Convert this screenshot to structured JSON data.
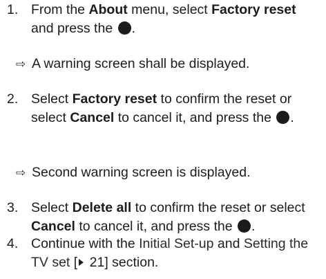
{
  "steps": [
    {
      "num": "1.",
      "t1": "From the ",
      "b1": "About",
      "t2": " menu, select ",
      "b2": "Factory reset",
      "t3": " and press the ",
      "t4": "."
    },
    {
      "num": "2.",
      "t1": "Select ",
      "b1": "Factory reset",
      "t2": " to confirm the reset or select ",
      "b2": "Cancel",
      "t3": " to cancel it, and press the ",
      "t4": "."
    },
    {
      "num": "3.",
      "t1": "Select ",
      "b1": "Delete all",
      "t2": " to confirm the reset or select ",
      "b2": "Cancel",
      "t3": " to cancel it, and press the ",
      "t4": "."
    },
    {
      "num": "4.",
      "t1": "Continue with the ",
      "link1": "Initial Set-up",
      "t2": " and ",
      "link2": "Setting the TV set",
      "ref_open": " [",
      "ref_page": " 21",
      "ref_close": "]",
      "t3": " section."
    }
  ],
  "results": [
    {
      "arrow": "⇨",
      "text": "A warning screen shall be displayed."
    },
    {
      "arrow": "⇨",
      "text": "Second warning screen is displayed."
    }
  ],
  "icons": {
    "button": "round-ok-button-icon",
    "arrow": "result-arrow-icon",
    "page_ref": "page-reference-triangle-icon"
  },
  "colors": {
    "text": "#1c1c1c",
    "button": "#1c1c1c"
  }
}
